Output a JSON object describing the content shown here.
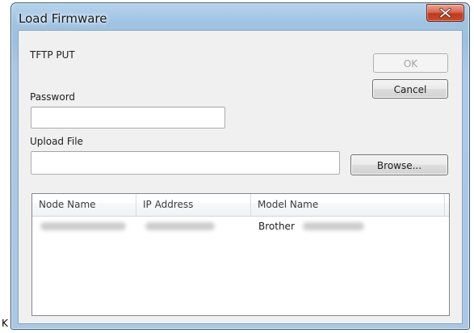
{
  "window": {
    "title": "Load Firmware",
    "close_icon": "close-icon"
  },
  "form": {
    "protocol_label": "TFTP PUT",
    "password_label": "Password",
    "password_value": "",
    "upload_label": "Upload File",
    "upload_value": ""
  },
  "buttons": {
    "ok": "OK",
    "cancel": "Cancel",
    "browse": "Browse..."
  },
  "list": {
    "columns": [
      "Node Name",
      "IP Address",
      "Model Name"
    ],
    "rows": [
      {
        "node_name": "",
        "ip_address": "",
        "model_name": "Brother"
      }
    ]
  },
  "fragment_text": "K"
}
